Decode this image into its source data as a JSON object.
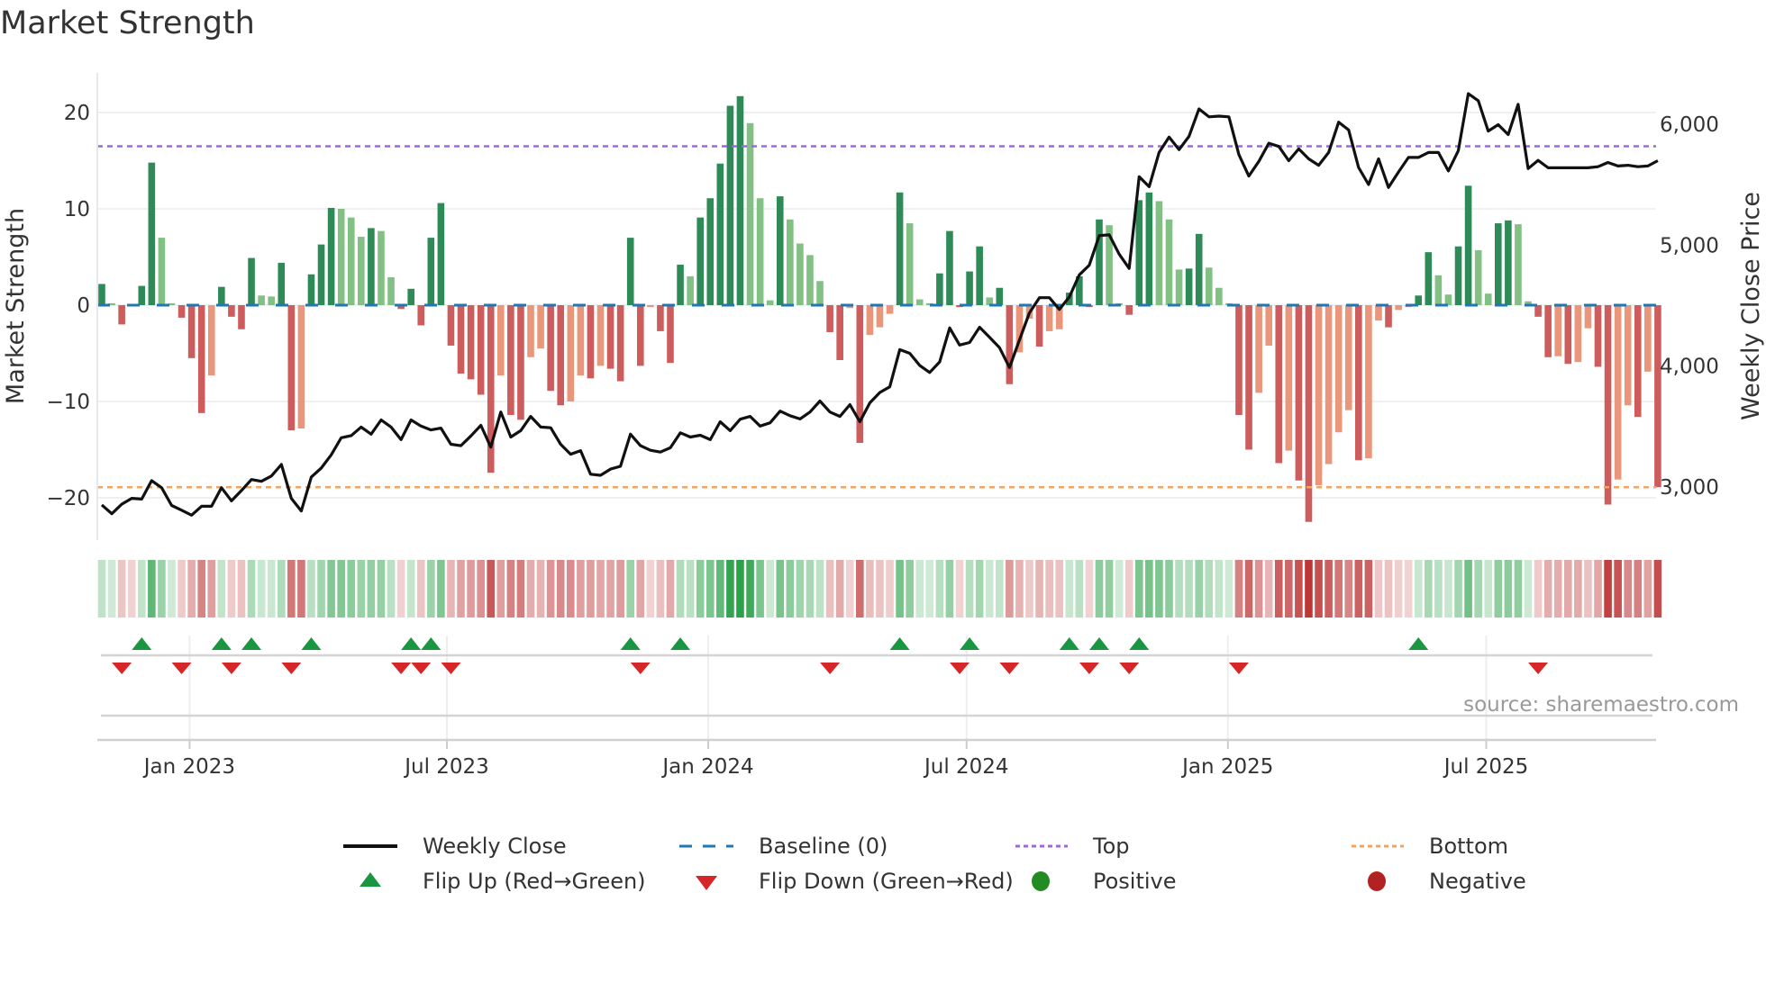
{
  "title": "Market Strength",
  "source": "source: sharemaestro.com",
  "legend": [
    {
      "label": "Weekly Close",
      "type": "line",
      "color": "#111111"
    },
    {
      "label": "Baseline (0)",
      "type": "dash",
      "color": "#1f77b4"
    },
    {
      "label": "Top",
      "type": "dot",
      "color": "#a066e0"
    },
    {
      "label": "Bottom",
      "type": "dot",
      "color": "#f4a460"
    },
    {
      "label": "Flip Up (Red→Green)",
      "type": "tri-up",
      "color": "#1a9641"
    },
    {
      "label": "Flip Down (Green→Red)",
      "type": "tri-down",
      "color": "#d62728"
    },
    {
      "label": "Positive",
      "type": "circle",
      "color": "#228b22"
    },
    {
      "label": "Negative",
      "type": "circle",
      "color": "#b22222"
    }
  ],
  "chart_data": {
    "type": "bar",
    "title": "Market Strength",
    "ylabel": "Market Strength",
    "y2label": "Weekly Close Price",
    "ylim": [
      -24,
      24.5
    ],
    "y2lim": [
      2550,
      6500
    ],
    "yticks": [
      20,
      10,
      0,
      -10,
      -20
    ],
    "yticklabels": [
      "20",
      "10",
      "0",
      "−10",
      "−20"
    ],
    "y2ticks": [
      6000,
      5000,
      4000,
      3000
    ],
    "y2ticklabels": [
      "6,000",
      "5,000",
      "4,000",
      "3,000"
    ],
    "xticks": [
      {
        "label": "Jan 2023",
        "week": 8.8
      },
      {
        "label": "Jul 2023",
        "week": 34.6
      },
      {
        "label": "Jan 2024",
        "week": 60.8
      },
      {
        "label": "Jul 2024",
        "week": 86.7
      },
      {
        "label": "Jan 2025",
        "week": 112.9
      },
      {
        "label": "Jul 2025",
        "week": 138.8
      }
    ],
    "levels": {
      "top": 16.5,
      "bottom": -18.9,
      "baseline": 0
    },
    "colors": {
      "pos_up": "#2e8b57",
      "pos_down": "#82c083",
      "neg_down": "#cd5c5c",
      "neg_up": "#e9967a",
      "price": "#111111",
      "baseline": "#1f77b4",
      "top": "#a066e0",
      "bottom": "#f4a460",
      "flip_up": "#1a9641",
      "flip_down": "#d62728"
    },
    "strength": [
      2.2,
      0.2,
      -2.0,
      -0.1,
      2.0,
      14.8,
      7.0,
      0.2,
      -1.3,
      -5.5,
      -11.2,
      -7.3,
      1.9,
      -1.2,
      -2.5,
      4.9,
      1.0,
      0.9,
      4.4,
      -13.0,
      -12.8,
      3.2,
      6.3,
      10.1,
      10.0,
      9.1,
      7.1,
      8.0,
      7.7,
      2.9,
      -0.4,
      1.7,
      -2.1,
      7.0,
      10.6,
      -4.2,
      -7.1,
      -7.7,
      -9.3,
      -17.4,
      -7.3,
      -11.4,
      -11.9,
      -5.4,
      -4.5,
      -8.9,
      -10.4,
      -10.0,
      -7.3,
      -7.6,
      -6.3,
      -6.6,
      -7.9,
      7.0,
      -6.3,
      -0.2,
      -2.7,
      -6.0,
      4.2,
      3.0,
      9.1,
      11.1,
      14.7,
      20.7,
      21.7,
      18.9,
      11.1,
      0.5,
      11.3,
      8.9,
      6.4,
      5.2,
      2.5,
      -2.8,
      -5.7,
      -0.3,
      -14.3,
      -3.1,
      -2.3,
      -0.9,
      11.7,
      8.5,
      0.6,
      0.2,
      3.3,
      7.7,
      -0.2,
      3.5,
      6.1,
      0.8,
      1.8,
      -8.2,
      -4.9,
      -1.4,
      -4.3,
      -2.7,
      -2.5,
      1.3,
      3.0,
      -0.2,
      8.9,
      8.3,
      0.2,
      -1.0,
      10.9,
      11.7,
      10.8,
      8.9,
      3.7,
      3.8,
      7.4,
      3.9,
      1.8,
      0.2,
      -11.4,
      -15.0,
      -9.1,
      -4.2,
      -16.4,
      -15.1,
      -18.2,
      -22.5,
      -18.7,
      -16.5,
      -13.2,
      -10.9,
      -16.1,
      -15.9,
      -1.6,
      -2.3,
      -0.5,
      -0.2,
      1.0,
      5.5,
      3.1,
      1.1,
      6.1,
      12.4,
      5.7,
      1.2,
      8.5,
      8.8,
      8.4,
      0.4,
      -1.2,
      -5.4,
      -5.3,
      -6.1,
      -5.9,
      -2.4,
      -6.4,
      -20.7,
      -18.1,
      -10.4,
      -11.6,
      -6.9,
      -18.9
    ],
    "weekly_close": [
      2852,
      2779,
      2858,
      2906,
      2900,
      3053,
      2994,
      2847,
      2808,
      2767,
      2841,
      2841,
      2994,
      2885,
      2971,
      3062,
      3047,
      3091,
      3186,
      2906,
      2802,
      3083,
      3156,
      3266,
      3407,
      3425,
      3496,
      3437,
      3555,
      3496,
      3392,
      3555,
      3504,
      3472,
      3487,
      3354,
      3342,
      3422,
      3510,
      3330,
      3620,
      3413,
      3466,
      3584,
      3496,
      3490,
      3354,
      3271,
      3301,
      3106,
      3097,
      3148,
      3171,
      3437,
      3342,
      3304,
      3289,
      3325,
      3448,
      3413,
      3428,
      3392,
      3540,
      3466,
      3561,
      3584,
      3504,
      3531,
      3628,
      3590,
      3563,
      3620,
      3711,
      3620,
      3584,
      3681,
      3540,
      3696,
      3782,
      3829,
      4136,
      4106,
      4006,
      3947,
      4035,
      4316,
      4174,
      4195,
      4322,
      4239,
      4153,
      3988,
      4215,
      4440,
      4566,
      4566,
      4469,
      4572,
      4755,
      4835,
      5080,
      5086,
      4926,
      4808,
      5567,
      5484,
      5767,
      5894,
      5791,
      5900,
      6127,
      6062,
      6068,
      6062,
      5749,
      5572,
      5693,
      5844,
      5817,
      5699,
      5797,
      5714,
      5661,
      5767,
      6018,
      5953,
      5643,
      5502,
      5714,
      5478,
      5605,
      5726,
      5726,
      5767,
      5767,
      5614,
      5782,
      6254,
      6195,
      5944,
      5997,
      5915,
      6165,
      5634,
      5702,
      5640,
      5640,
      5640,
      5640,
      5640,
      5649,
      5684,
      5655,
      5661,
      5649,
      5655,
      5699
    ],
    "flip_up_weeks": [
      4,
      12,
      15,
      21,
      31,
      33,
      53,
      58,
      80,
      87,
      97,
      100,
      104,
      132
    ],
    "flip_down_weeks": [
      2,
      8,
      13,
      19,
      30,
      32,
      35,
      54,
      73,
      86,
      91,
      99,
      103,
      114,
      144
    ]
  }
}
